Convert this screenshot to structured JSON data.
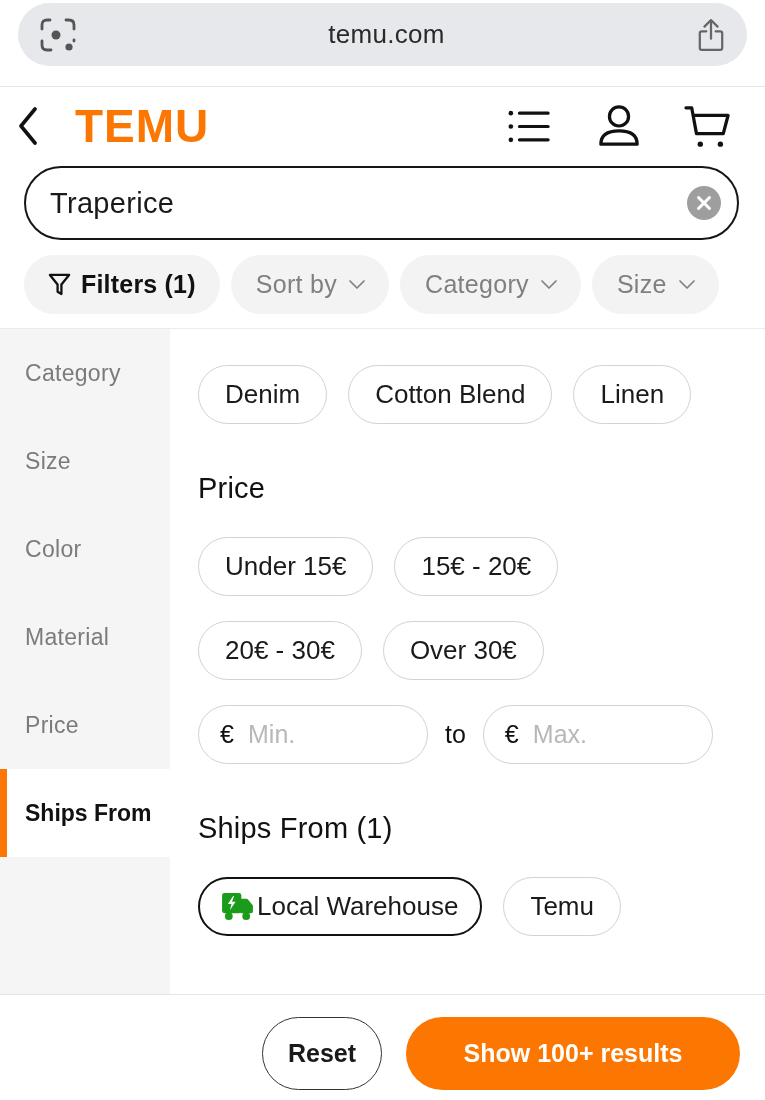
{
  "browser": {
    "url": "temu.com"
  },
  "header": {
    "logo": "TEMU"
  },
  "search": {
    "value": "Traperice"
  },
  "filter_chips": [
    {
      "label": "Filters (1)",
      "kind": "filters",
      "selected": true
    },
    {
      "label": "Sort by",
      "kind": "dropdown",
      "selected": false
    },
    {
      "label": "Category",
      "kind": "dropdown",
      "selected": false
    },
    {
      "label": "Size",
      "kind": "dropdown",
      "selected": false
    }
  ],
  "sidebar": {
    "items": [
      {
        "label": "Category",
        "selected": false
      },
      {
        "label": "Size",
        "selected": false
      },
      {
        "label": "Color",
        "selected": false
      },
      {
        "label": "Material",
        "selected": false
      },
      {
        "label": "Price",
        "selected": false
      },
      {
        "label": "Ships From",
        "selected": true
      }
    ]
  },
  "sections": [
    {
      "rows": [
        [
          {
            "label": "Denim",
            "selected": false
          },
          {
            "label": "Cotton Blend",
            "selected": false
          },
          {
            "label": "Linen",
            "selected": false
          }
        ]
      ]
    },
    {
      "heading": "Price",
      "rows": [
        [
          {
            "label": "Under 15€",
            "selected": false
          },
          {
            "label": "15€ - 20€",
            "selected": false
          }
        ],
        [
          {
            "label": "20€ - 30€",
            "selected": false
          },
          {
            "label": "Over 30€",
            "selected": false
          }
        ]
      ],
      "range": {
        "min": {
          "prefix": "€",
          "placeholder": "Min."
        },
        "separator": "to",
        "max": {
          "prefix": "€",
          "placeholder": "Max."
        }
      }
    },
    {
      "heading": "Ships From (1)",
      "rows": [
        [
          {
            "label": "Local Warehouse",
            "kind": "local",
            "selected": true
          },
          {
            "label": "Temu",
            "kind": "plain",
            "selected": false
          }
        ]
      ]
    }
  ],
  "footer": {
    "buttons": [
      {
        "label": "Reset",
        "kind": "secondary"
      },
      {
        "label": "Show 100+ results",
        "kind": "primary"
      }
    ]
  }
}
